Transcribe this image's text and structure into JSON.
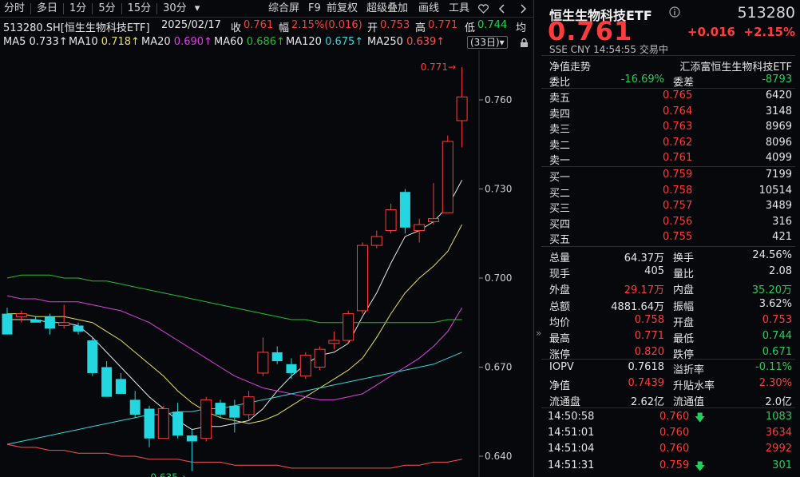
{
  "toolbar": {
    "left": [
      "分时",
      "多日",
      "1分",
      "5分",
      "15分",
      "30分"
    ],
    "dropdown": "▾",
    "right": [
      "综合屏",
      "F9",
      "前复权",
      "超级叠加",
      "画线",
      "工具"
    ],
    "extra_icons": [
      "heart-icon",
      "nav-left-icon",
      "nav-right-icon"
    ]
  },
  "info": {
    "name": "513280.SH[恒生生物科技ETF]",
    "date": "2025/02/17",
    "close_label": "收",
    "close": "0.761",
    "amp_label": "幅",
    "amp": "2.15%(0.016)",
    "open_label": "开",
    "open": "0.753",
    "high_label": "高",
    "high": "0.771",
    "low_label": "低",
    "low": "0.744",
    "tail": "均"
  },
  "ma": [
    {
      "label": "MA5",
      "value": "0.733↑",
      "color": "#e8e8e8"
    },
    {
      "label": "MA10",
      "value": "0.718↑",
      "color": "#e8e055"
    },
    {
      "label": "MA20",
      "value": "0.690↑",
      "color": "#e040e0"
    },
    {
      "label": "MA60",
      "value": "0.686↑",
      "color": "#20c030"
    },
    {
      "label": "MA120",
      "value": "0.675↑",
      "color": "#30d8d8"
    },
    {
      "label": "MA250",
      "value": "0.639↑",
      "color": "#ff5050"
    }
  ],
  "days_button": "(33日)▾",
  "chart_data": {
    "type": "candlestick",
    "y_ticks": [
      "0.760",
      "0.730",
      "0.700",
      "0.670",
      "0.640"
    ],
    "y_range": [
      0.633,
      0.775
    ],
    "max_label": "0.771→",
    "min_label": "0.635→",
    "candles": [
      {
        "o": 0.688,
        "h": 0.69,
        "l": 0.681,
        "c": 0.681
      },
      {
        "o": 0.687,
        "h": 0.689,
        "l": 0.685,
        "c": 0.688
      },
      {
        "o": 0.686,
        "h": 0.687,
        "l": 0.685,
        "c": 0.685
      },
      {
        "o": 0.687,
        "h": 0.688,
        "l": 0.681,
        "c": 0.683
      },
      {
        "o": 0.684,
        "h": 0.691,
        "l": 0.683,
        "c": 0.685
      },
      {
        "o": 0.684,
        "h": 0.685,
        "l": 0.681,
        "c": 0.682
      },
      {
        "o": 0.679,
        "h": 0.68,
        "l": 0.667,
        "c": 0.668
      },
      {
        "o": 0.67,
        "h": 0.672,
        "l": 0.66,
        "c": 0.66
      },
      {
        "o": 0.666,
        "h": 0.668,
        "l": 0.661,
        "c": 0.661
      },
      {
        "o": 0.659,
        "h": 0.662,
        "l": 0.653,
        "c": 0.654
      },
      {
        "o": 0.656,
        "h": 0.657,
        "l": 0.643,
        "c": 0.646
      },
      {
        "o": 0.646,
        "h": 0.657,
        "l": 0.646,
        "c": 0.656
      },
      {
        "o": 0.655,
        "h": 0.658,
        "l": 0.646,
        "c": 0.647
      },
      {
        "o": 0.647,
        "h": 0.649,
        "l": 0.635,
        "c": 0.645
      },
      {
        "o": 0.646,
        "h": 0.66,
        "l": 0.645,
        "c": 0.659
      },
      {
        "o": 0.658,
        "h": 0.659,
        "l": 0.653,
        "c": 0.654
      },
      {
        "o": 0.657,
        "h": 0.659,
        "l": 0.648,
        "c": 0.653
      },
      {
        "o": 0.654,
        "h": 0.662,
        "l": 0.652,
        "c": 0.66
      },
      {
        "o": 0.668,
        "h": 0.68,
        "l": 0.667,
        "c": 0.675
      },
      {
        "o": 0.675,
        "h": 0.677,
        "l": 0.671,
        "c": 0.672
      },
      {
        "o": 0.671,
        "h": 0.673,
        "l": 0.666,
        "c": 0.668
      },
      {
        "o": 0.667,
        "h": 0.675,
        "l": 0.666,
        "c": 0.674
      },
      {
        "o": 0.67,
        "h": 0.677,
        "l": 0.669,
        "c": 0.676
      },
      {
        "o": 0.678,
        "h": 0.682,
        "l": 0.676,
        "c": 0.679
      },
      {
        "o": 0.679,
        "h": 0.689,
        "l": 0.678,
        "c": 0.688
      },
      {
        "o": 0.689,
        "h": 0.712,
        "l": 0.688,
        "c": 0.711
      },
      {
        "o": 0.711,
        "h": 0.716,
        "l": 0.71,
        "c": 0.714
      },
      {
        "o": 0.716,
        "h": 0.725,
        "l": 0.715,
        "c": 0.723
      },
      {
        "o": 0.729,
        "h": 0.73,
        "l": 0.715,
        "c": 0.717
      },
      {
        "o": 0.716,
        "h": 0.72,
        "l": 0.712,
        "c": 0.718
      },
      {
        "o": 0.719,
        "h": 0.732,
        "l": 0.718,
        "c": 0.72
      },
      {
        "o": 0.722,
        "h": 0.748,
        "l": 0.722,
        "c": 0.746
      },
      {
        "o": 0.753,
        "h": 0.771,
        "l": 0.744,
        "c": 0.761
      }
    ],
    "ma_series": [
      {
        "name": "MA5",
        "color": "#e8e8e8",
        "values": [
          0.686,
          0.686,
          0.686,
          0.685,
          0.685,
          0.684,
          0.68,
          0.675,
          0.67,
          0.665,
          0.66,
          0.656,
          0.652,
          0.649,
          0.65,
          0.65,
          0.651,
          0.652,
          0.656,
          0.662,
          0.667,
          0.671,
          0.674,
          0.675,
          0.678,
          0.687,
          0.695,
          0.705,
          0.714,
          0.716,
          0.719,
          0.724,
          0.733
        ]
      },
      {
        "name": "MA10",
        "color": "#e8e055",
        "values": [
          0.688,
          0.688,
          0.687,
          0.687,
          0.687,
          0.686,
          0.685,
          0.682,
          0.679,
          0.675,
          0.671,
          0.667,
          0.662,
          0.658,
          0.655,
          0.653,
          0.652,
          0.651,
          0.652,
          0.654,
          0.657,
          0.66,
          0.663,
          0.666,
          0.669,
          0.673,
          0.68,
          0.688,
          0.695,
          0.7,
          0.704,
          0.709,
          0.718
        ]
      },
      {
        "name": "MA20",
        "color": "#e040e0",
        "values": [
          0.694,
          0.693,
          0.693,
          0.692,
          0.692,
          0.692,
          0.691,
          0.69,
          0.689,
          0.687,
          0.685,
          0.682,
          0.679,
          0.676,
          0.673,
          0.67,
          0.667,
          0.665,
          0.663,
          0.662,
          0.661,
          0.66,
          0.659,
          0.659,
          0.66,
          0.661,
          0.664,
          0.667,
          0.67,
          0.673,
          0.677,
          0.682,
          0.69
        ]
      },
      {
        "name": "MA60",
        "color": "#20c030",
        "values": [
          0.7,
          0.701,
          0.701,
          0.701,
          0.7,
          0.7,
          0.699,
          0.699,
          0.698,
          0.697,
          0.696,
          0.695,
          0.694,
          0.693,
          0.692,
          0.691,
          0.69,
          0.689,
          0.688,
          0.687,
          0.686,
          0.686,
          0.685,
          0.685,
          0.685,
          0.685,
          0.685,
          0.685,
          0.685,
          0.685,
          0.685,
          0.686,
          0.686
        ]
      },
      {
        "name": "MA120",
        "color": "#30d8d8",
        "values": [
          0.644,
          0.645,
          0.646,
          0.647,
          0.648,
          0.649,
          0.65,
          0.651,
          0.652,
          0.653,
          0.654,
          0.654,
          0.655,
          0.655,
          0.656,
          0.656,
          0.657,
          0.658,
          0.659,
          0.66,
          0.661,
          0.662,
          0.663,
          0.664,
          0.665,
          0.666,
          0.667,
          0.668,
          0.669,
          0.67,
          0.671,
          0.673,
          0.675
        ]
      },
      {
        "name": "MA250",
        "color": "#ff5050",
        "values": [
          0.644,
          0.643,
          0.643,
          0.642,
          0.642,
          0.641,
          0.641,
          0.641,
          0.64,
          0.64,
          0.639,
          0.639,
          0.639,
          0.638,
          0.638,
          0.638,
          0.637,
          0.637,
          0.637,
          0.637,
          0.636,
          0.636,
          0.636,
          0.636,
          0.636,
          0.636,
          0.636,
          0.636,
          0.637,
          0.637,
          0.638,
          0.638,
          0.639
        ]
      }
    ]
  },
  "panel": {
    "title": "恒生生物科技ETF",
    "code": "513280",
    "price": "0.761",
    "change": "+0.016",
    "change_pct": "+2.15%",
    "meta": "SSE  CNY  14:54:55  交易中",
    "nav_label": "净值走势",
    "fund_company": "汇添富恒生生物科技ETF",
    "weibi_label": "委比",
    "weibi": "-16.69%",
    "weicha_label": "委差",
    "weicha": "-8793",
    "sell": [
      {
        "label": "卖五",
        "price": "0.765",
        "vol": "6420"
      },
      {
        "label": "卖四",
        "price": "0.764",
        "vol": "3148"
      },
      {
        "label": "卖三",
        "price": "0.763",
        "vol": "8969"
      },
      {
        "label": "卖二",
        "price": "0.762",
        "vol": "8096"
      },
      {
        "label": "卖一",
        "price": "0.761",
        "vol": "4099"
      }
    ],
    "buy": [
      {
        "label": "买一",
        "price": "0.759",
        "vol": "7199"
      },
      {
        "label": "买二",
        "price": "0.758",
        "vol": "10514"
      },
      {
        "label": "买三",
        "price": "0.757",
        "vol": "3489"
      },
      {
        "label": "买四",
        "price": "0.756",
        "vol": "316"
      },
      {
        "label": "买五",
        "price": "0.755",
        "vol": "421"
      }
    ],
    "stats": [
      {
        "l1": "总量",
        "v1": "64.37万",
        "c1": "white",
        "l2": "换手",
        "v2": "24.56%",
        "c2": "white"
      },
      {
        "l1": "现手",
        "v1": "405",
        "c1": "white",
        "l2": "量比",
        "v2": "2.08",
        "c2": "white"
      },
      {
        "l1": "外盘",
        "v1": "29.17万",
        "c1": "red",
        "l2": "内盘",
        "v2": "35.20万",
        "c2": "green"
      },
      {
        "l1": "总额",
        "v1": "4881.64万",
        "c1": "white",
        "l2": "振幅",
        "v2": "3.62%",
        "c2": "white"
      },
      {
        "l1": "均价",
        "v1": "0.758",
        "c1": "red",
        "l2": "开盘",
        "v2": "0.753",
        "c2": "red"
      },
      {
        "l1": "最高",
        "v1": "0.771",
        "c1": "red",
        "l2": "最低",
        "v2": "0.744",
        "c2": "green"
      },
      {
        "l1": "涨停",
        "v1": "0.820",
        "c1": "red",
        "l2": "跌停",
        "v2": "0.671",
        "c2": "green"
      }
    ],
    "fund": [
      {
        "l1": "IOPV",
        "v1": "0.7618",
        "c1": "white",
        "l2": "溢折率",
        "v2": "-0.11%",
        "c2": "green"
      },
      {
        "l1": "净值",
        "v1": "0.7439",
        "c1": "red",
        "l2": "升贴水率",
        "v2": "2.30%",
        "c2": "red"
      },
      {
        "l1": "流通盘",
        "v1": "2.62亿",
        "c1": "white",
        "l2": "流通值",
        "v2": "2.0亿",
        "c2": "white"
      }
    ],
    "ticks": [
      {
        "time": "14:50:58",
        "price": "0.760",
        "arrow": "🡇",
        "vol": "1083",
        "vcolor": "green"
      },
      {
        "time": "14:51:01",
        "price": "0.760",
        "arrow": "",
        "vol": "3634",
        "vcolor": "red"
      },
      {
        "time": "14:51:04",
        "price": "0.760",
        "arrow": "",
        "vol": "2992",
        "vcolor": "red"
      },
      {
        "time": "14:51:31",
        "price": "0.759",
        "arrow": "🡇",
        "vol": "301",
        "vcolor": "green"
      }
    ]
  }
}
